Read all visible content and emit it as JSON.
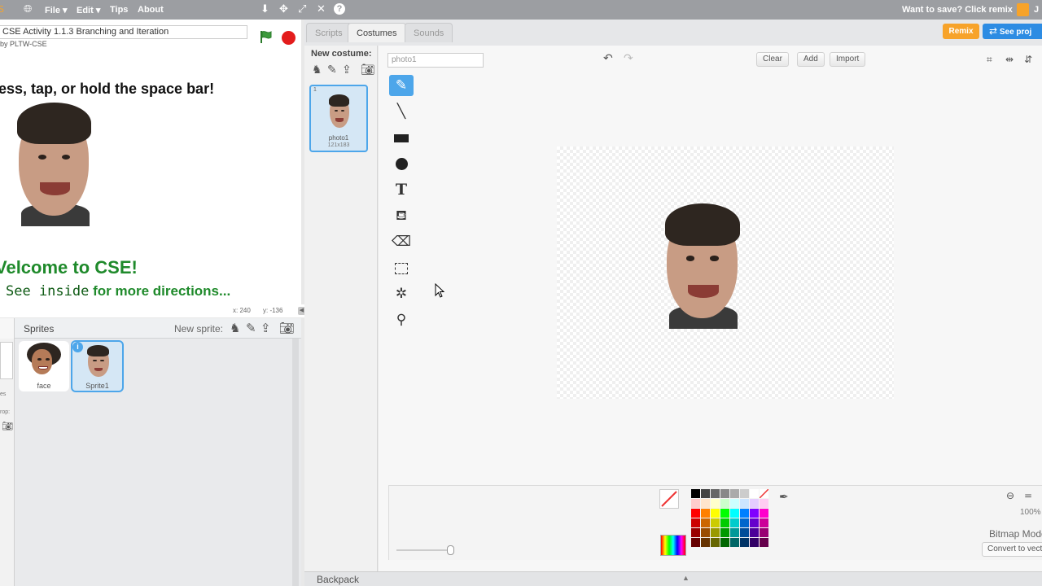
{
  "menu": {
    "file": "File",
    "edit": "Edit",
    "tips": "Tips",
    "about": "About",
    "save_prompt": "Want to save? Click remix",
    "user_initial": "J"
  },
  "project": {
    "title": "CSE Activity 1.1.3 Branching and Iteration",
    "author": "by PLTW-CSE"
  },
  "stage": {
    "instruction": "ess, tap, or hold the space bar!",
    "welcome": "Velcome to CSE!",
    "see_inside": "See inside",
    "more_directions": "for more directions...",
    "coords_x": "x: 240",
    "coords_y": "y: -136"
  },
  "tabs": {
    "scripts": "Scripts",
    "costumes": "Costumes",
    "sounds": "Sounds"
  },
  "buttons": {
    "remix": "Remix",
    "see_project": "See proj"
  },
  "costumes": {
    "new_costume_label": "New costume:",
    "items": [
      {
        "index": "1",
        "name": "photo1",
        "size": "121x183"
      }
    ]
  },
  "editor": {
    "costume_name": "photo1",
    "clear": "Clear",
    "add": "Add",
    "import": "Import",
    "zoom": "100%",
    "mode": "Bitmap Mode",
    "convert": "Convert to vect"
  },
  "sprites": {
    "header": "Sprites",
    "new_sprite_label": "New sprite:",
    "items": [
      {
        "name": "face"
      },
      {
        "name": "Sprite1"
      }
    ],
    "stage_fragment_1": "es",
    "stage_fragment_2": "rop:"
  },
  "backpack": {
    "label": "Backpack"
  },
  "colors": {
    "accent_blue": "#4da6ea",
    "remix_orange": "#f7a32a",
    "welcome_green": "#1f8a2b",
    "menubar_gray": "#9c9ea2"
  }
}
